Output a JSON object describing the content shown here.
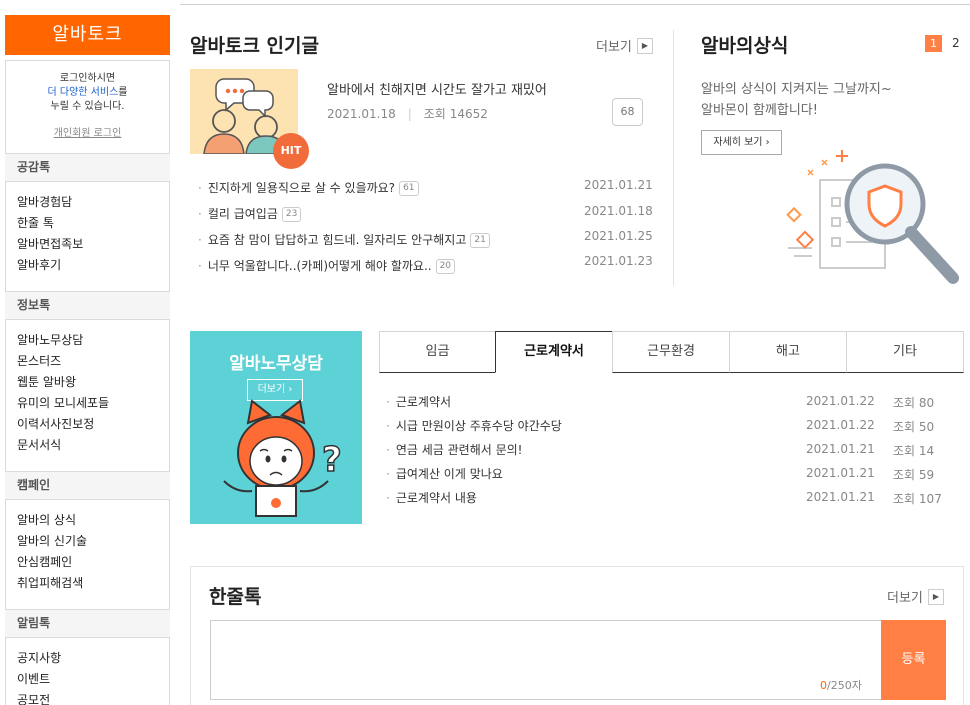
{
  "sidebar": {
    "title": "알바토크",
    "login_line1": "로그인하시면",
    "login_line2": "더 다양한 서비스",
    "login_line2_suffix": "를",
    "login_line3": "누릴 수 있습니다.",
    "login_link": "개인회원 로그인",
    "groups": [
      {
        "head": "공감톡",
        "items": [
          "알바경험담",
          "한줄 톡",
          "알바면접족보",
          "알바후기"
        ]
      },
      {
        "head": "정보톡",
        "items": [
          "알바노무상담",
          "몬스터즈",
          "웹툰 알바왕",
          "유미의 모니세포들",
          "이력서사진보정",
          "문서서식"
        ]
      },
      {
        "head": "캠페인",
        "items": [
          "알바의 상식",
          "알바의 신기술",
          "안심캠페인",
          "취업피해검색"
        ]
      },
      {
        "head": "알림톡",
        "items": [
          "공지사항",
          "이벤트",
          "공모전"
        ]
      }
    ]
  },
  "popular": {
    "title": "알바토크 인기글",
    "more": "더보기",
    "hit_badge": "HIT",
    "hit_title": "알바에서 친해지면 시간도 잘가고 재밌어",
    "hit_date": "2021.01.18",
    "hit_views_label": "조회",
    "hit_views": "14652",
    "hit_comments": "68",
    "posts": [
      {
        "title": "진지하게 일용직으로 살 수 있을까요?",
        "count": "61",
        "date": "2021.01.21"
      },
      {
        "title": "컬리 급여입금",
        "count": "23",
        "date": "2021.01.18"
      },
      {
        "title": "요즘 참 맘이 답답하고 힘드네. 일자리도 안구해지고",
        "count": "21",
        "date": "2021.01.25"
      },
      {
        "title": "너무 억울합니다..(카페)어떻게 해야 할까요..",
        "count": "20",
        "date": "2021.01.23"
      }
    ]
  },
  "knowledge": {
    "title": "알바의상식",
    "page_current": "1",
    "page_next": "2",
    "desc_line1": "알바의 상식이 지켜지는 그날까지~",
    "desc_line2": "알바몬이 함께합니다!",
    "button": "자세히 보기"
  },
  "consult": {
    "title": "알바노무상담",
    "more": "더보기",
    "tabs": [
      "임금",
      "근로계약서",
      "근무환경",
      "해고",
      "기타"
    ],
    "active_tab": "근로계약서",
    "views_label": "조회",
    "posts": [
      {
        "title": "근로계약서",
        "date": "2021.01.22",
        "views": "80"
      },
      {
        "title": "시급 만원이상 주휴수당 야간수당",
        "date": "2021.01.22",
        "views": "50"
      },
      {
        "title": "연금 세금 관련해서 문의!",
        "date": "2021.01.21",
        "views": "14"
      },
      {
        "title": "급여계산 이게 맞나요",
        "date": "2021.01.21",
        "views": "59"
      },
      {
        "title": "근로계약서 내용",
        "date": "2021.01.21",
        "views": "107"
      }
    ]
  },
  "talk": {
    "title": "한줄톡",
    "more": "더보기",
    "count": "0",
    "max": "/250자",
    "submit": "등록"
  },
  "colors": {
    "accent": "#ff6600",
    "accent_soft": "#ff7f45",
    "teal": "#5cd1d6",
    "link_blue": "#1a5fcc"
  }
}
